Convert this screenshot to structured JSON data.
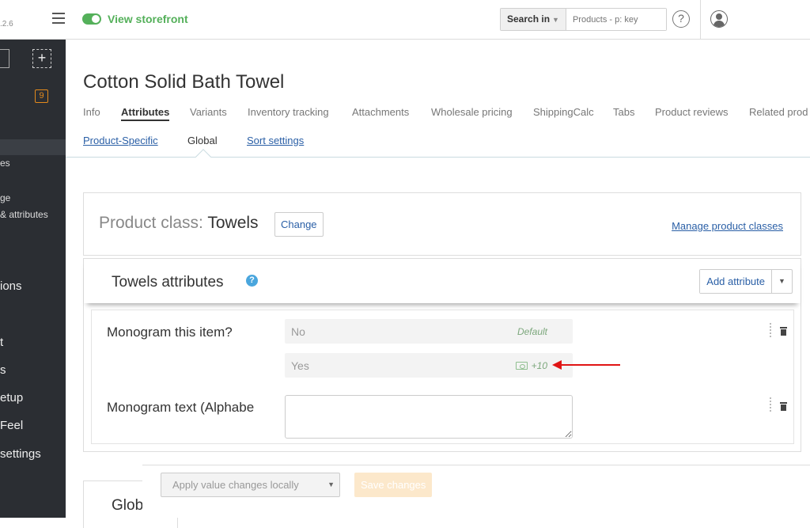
{
  "header": {
    "version": ".2.6",
    "storefront_label": "View storefront",
    "search_label": "Search in",
    "search_placeholder": "Products - p: key",
    "help_glyph": "?"
  },
  "sidebar": {
    "badge_count": "9",
    "plus_glyph": "+",
    "items": [
      {
        "label": "es"
      },
      {
        "label": "ge"
      },
      {
        "label": "& attributes"
      },
      {
        "label": "ions"
      },
      {
        "label": "t"
      },
      {
        "label": "s"
      },
      {
        "label": "etup"
      },
      {
        "label": "Feel"
      },
      {
        "label": "settings"
      }
    ]
  },
  "page": {
    "title": "Cotton Solid Bath Towel",
    "tabs": [
      {
        "label": "Info"
      },
      {
        "label": "Attributes"
      },
      {
        "label": "Variants"
      },
      {
        "label": "Inventory tracking"
      },
      {
        "label": "Attachments"
      },
      {
        "label": "Wholesale pricing"
      },
      {
        "label": "ShippingCalc"
      },
      {
        "label": "Tabs"
      },
      {
        "label": "Product reviews"
      },
      {
        "label": "Related prod"
      }
    ],
    "active_tab": "Attributes",
    "subtabs": [
      {
        "label": "Product-Specific"
      },
      {
        "label": "Global"
      },
      {
        "label": "Sort settings"
      }
    ],
    "active_subtab": "Global"
  },
  "product_class": {
    "label": "Product class:",
    "value": "Towels",
    "change_label": "Change",
    "manage_link": "Manage product classes"
  },
  "attributes": {
    "title": "Towels attributes",
    "help_glyph": "?",
    "add_label": "Add attribute",
    "items": [
      {
        "name": "Monogram this item?",
        "values": [
          {
            "text": "No",
            "tag": "Default"
          },
          {
            "text": "Yes",
            "modifier": "+10"
          }
        ]
      },
      {
        "name": "Monogram text (Alphabe"
      }
    ]
  },
  "lower_section": {
    "title": "Glob"
  },
  "footer": {
    "apply_label": "Apply value changes locally",
    "save_label": "Save changes"
  },
  "colors": {
    "accent_green": "#54b05a",
    "link_blue": "#2a5fa6",
    "badge_orange": "#e38a1c",
    "sidebar_bg": "#2b2e33",
    "annotation_red": "#e01414"
  }
}
